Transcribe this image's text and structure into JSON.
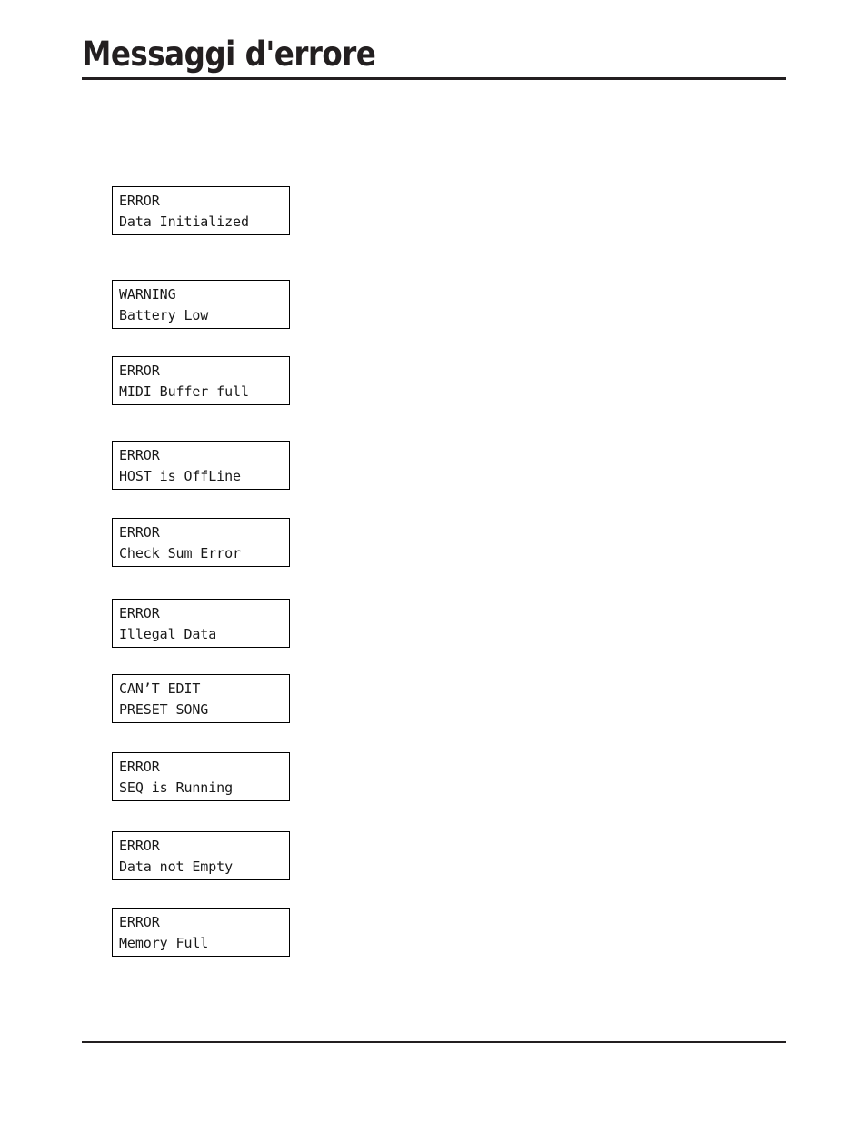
{
  "page": {
    "title": "Messaggi d'errore",
    "background_color": "#ffffff",
    "text_color": "#231f20"
  },
  "rules": {
    "top": "",
    "bottom": ""
  },
  "lcd_messages": [
    {
      "line1": "ERROR",
      "line2": "Data Initialized"
    },
    {
      "line1": "WARNING",
      "line2": "Battery Low"
    },
    {
      "line1": "ERROR",
      "line2": "MIDI Buffer full"
    },
    {
      "line1": "ERROR",
      "line2": "HOST is OffLine"
    },
    {
      "line1": "ERROR",
      "line2": "Check Sum Error"
    },
    {
      "line1": "ERROR",
      "line2": "Illegal Data"
    },
    {
      "line1": "CAN’T EDIT",
      "line2": "PRESET SONG"
    },
    {
      "line1": "ERROR",
      "line2": "SEQ is Running"
    },
    {
      "line1": "ERROR",
      "line2": "Data not Empty"
    },
    {
      "line1": "ERROR",
      "line2": "Memory Full"
    }
  ],
  "layout": {
    "box_tops": [
      205,
      308,
      392,
      485,
      570,
      659,
      742,
      828,
      915,
      999
    ]
  }
}
